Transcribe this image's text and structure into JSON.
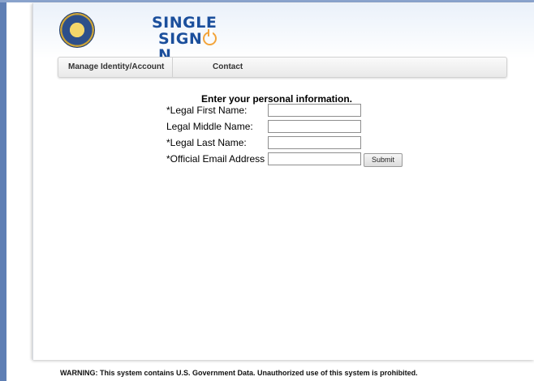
{
  "header": {
    "seal_name": "treasury-seal",
    "logo": {
      "line1": "SINGLE",
      "line2_prefix": "SIGN",
      "line2_suffix": "N"
    }
  },
  "nav": {
    "items": [
      {
        "label": "Manage Identity/Account"
      },
      {
        "label": "Contact"
      }
    ]
  },
  "form": {
    "title": "Enter your personal information.",
    "fields": [
      {
        "label": "*Legal First Name:",
        "value": ""
      },
      {
        "label": "Legal Middle Name:",
        "value": ""
      },
      {
        "label": "*Legal Last Name:",
        "value": ""
      },
      {
        "label": "*Official Email Address",
        "value": ""
      }
    ],
    "submit_label": "Submit"
  },
  "footer": {
    "warning": "WARNING: This system contains U.S. Government Data. Unauthorized use of this system is prohibited."
  },
  "colors": {
    "brand_blue": "#1b4f9c",
    "accent_orange": "#f3a43b",
    "frame_blue": "#5f7fb4"
  }
}
